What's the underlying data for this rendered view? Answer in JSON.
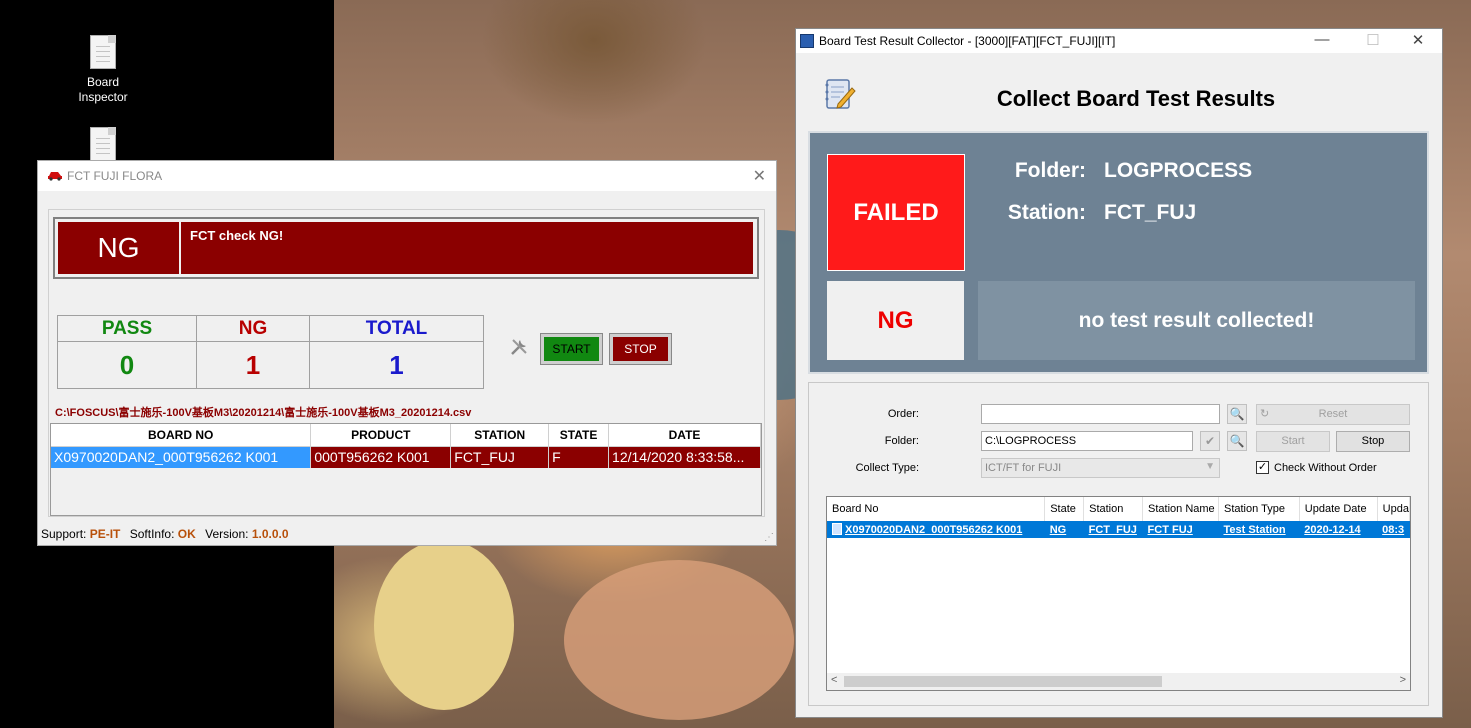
{
  "desktop": {
    "icons": [
      {
        "label_line1": "Board",
        "label_line2": "Inspector"
      },
      {
        "label_line1": "",
        "label_line2": ""
      }
    ]
  },
  "fct_window": {
    "title": "FCT FUJI FLORA",
    "close_glyph": "✕",
    "result_label": "NG",
    "result_message": "FCT check NG!",
    "stats": {
      "pass_label": "PASS",
      "ng_label": "NG",
      "total_label": "TOTAL",
      "pass_value": 0,
      "ng_value": 1,
      "total_value": 1,
      "pass_color": "#118811",
      "ng_color": "#b80000",
      "total_color": "#1a1acc"
    },
    "start_label": "START",
    "stop_label": "STOP",
    "file_path": "C:\\FOSCUS\\富士施乐-100V基板M3\\20201214\\富士施乐-100V基板M3_20201214.csv",
    "grid": {
      "columns": [
        "BOARD NO",
        "PRODUCT",
        "STATION",
        "STATE",
        "DATE"
      ],
      "rows": [
        [
          "X0970020DAN2_000T956262 K001",
          "000T956262 K001",
          "FCT_FUJ",
          "F",
          "12/14/2020 8:33:58..."
        ]
      ]
    },
    "status": {
      "support_label": "Support:",
      "support_value": "PE-IT",
      "softinfo_label": "SoftInfo:",
      "softinfo_value": "OK",
      "version_label": "Version:",
      "version_value": "1.0.0.0"
    }
  },
  "collector_window": {
    "title": "Board Test Result Collector - [3000][FAT][FCT_FUJI][IT]",
    "minimize_glyph": "—",
    "maximize_glyph": "☐",
    "close_glyph": "✕",
    "heading": "Collect Board Test Results",
    "status_text": "FAILED",
    "folder_label": "Folder:",
    "folder_value": "LOGPROCESS",
    "station_label": "Station:",
    "station_value": "FCT_FUJ",
    "result_text": "NG",
    "result_message": "no test result collected!",
    "form": {
      "order_label": "Order:",
      "order_value": "",
      "folder_label": "Folder:",
      "folder_value": "C:\\LOGPROCESS",
      "collect_type_label": "Collect Type:",
      "collect_type_value": "ICT/FT for FUJI",
      "reset_label": "Reset",
      "start_label": "Start",
      "stop_label": "Stop",
      "check_without_order_label": "Check Without Order",
      "check_without_order_checked": true
    },
    "list": {
      "columns": [
        "Board No",
        "State",
        "Station",
        "Station Name",
        "Station Type",
        "Update Date",
        "Upda"
      ],
      "rows": [
        [
          "X0970020DAN2_000T956262 K001",
          "NG",
          "FCT_FUJ",
          "FCT FUJ",
          "Test Station",
          "2020-12-14",
          "08:3"
        ]
      ]
    },
    "colors": {
      "failed": "#ff1a1a",
      "panel": "#6e8294",
      "selection": "#0078d7"
    }
  }
}
